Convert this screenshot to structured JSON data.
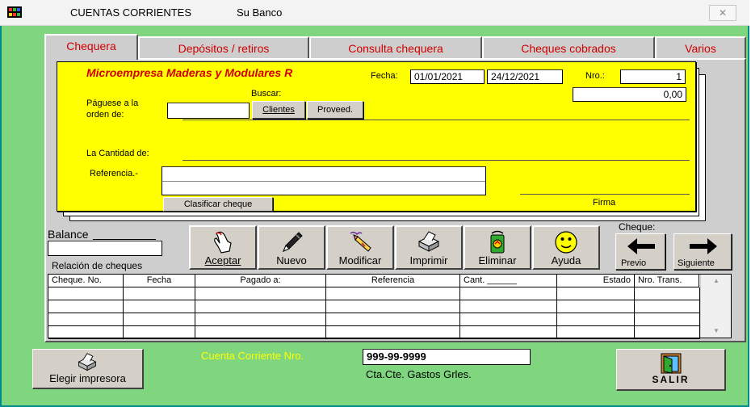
{
  "window": {
    "title": "CUENTAS CORRIENTES",
    "bank": "Su Banco",
    "close_icon": "close-icon"
  },
  "tabs": [
    {
      "label": "Chequera",
      "active": true
    },
    {
      "label": "Depósitos / retiros",
      "active": false
    },
    {
      "label": "Consulta chequera",
      "active": false
    },
    {
      "label": "Cheques cobrados",
      "active": false
    },
    {
      "label": "Varios",
      "active": false
    }
  ],
  "cheque": {
    "company": "Microempresa Maderas y Modulares R",
    "fecha_label": "Fecha:",
    "fecha1": "01/01/2021",
    "fecha2": "24/12/2021",
    "nro_label": "Nro.:",
    "nro_value": "1",
    "amount_value": "0,00",
    "buscar_label": "Buscar:",
    "paguese_label1": "Páguese a la",
    "paguese_label2": "orden de:",
    "payee_value": "",
    "clientes_button": "Clientes",
    "proveed_button": "Proveed.",
    "cantidad_label": "La Cantidad de:",
    "referencia_label": "Referencia.-",
    "referencia_value": "",
    "clasificar_button": "Clasificar cheque",
    "firma_label": "Firma"
  },
  "balance": {
    "label": "Balance",
    "value": ""
  },
  "toolbar": [
    {
      "label": "Aceptar",
      "icon": "hand-icon"
    },
    {
      "label": "Nuevo",
      "icon": "pen-icon"
    },
    {
      "label": "Modificar",
      "icon": "eraser-pen-icon"
    },
    {
      "label": "Imprimir",
      "icon": "printer-icon"
    },
    {
      "label": "Eliminar",
      "icon": "recycle-bin-icon"
    },
    {
      "label": "Ayuda",
      "icon": "smiley-icon"
    }
  ],
  "cheque_nav": {
    "label": "Cheque:",
    "prev_label": "Previo",
    "next_label": "Siguiente"
  },
  "relacion_label": "Relación de cheques",
  "grid": {
    "columns": [
      "Cheque. No.",
      "Fecha",
      "Pagado a:",
      "Referencia",
      "Cant. ______",
      "Estado",
      "Nro. Trans."
    ],
    "rows": 4
  },
  "footer": {
    "elegir_button": "Elegir impresora",
    "cuenta_label": "Cuenta Corriente Nro.",
    "cuenta_value": "999-99-9999",
    "cuenta_desc": "Cta.Cte. Gastos Grles.",
    "salir_button": "SALIR"
  },
  "colors": {
    "window_bg": "#7fd67f",
    "cheque_bg": "#ffff00",
    "tab_text": "#d00000",
    "company_text": "#d00000",
    "cuenta_label_text": "#ffff00"
  }
}
